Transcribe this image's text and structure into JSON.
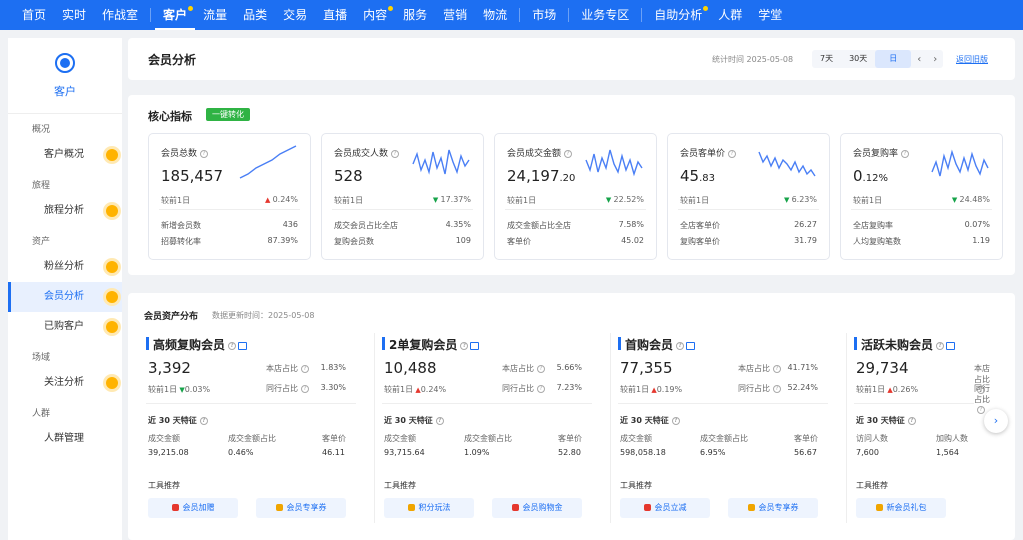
{
  "topnav": {
    "items": [
      {
        "label": "首页",
        "active": false,
        "dot": false
      },
      {
        "label": "实时",
        "active": false,
        "dot": false
      },
      {
        "label": "作战室",
        "active": false,
        "dot": false
      },
      {
        "label": "客户",
        "active": true,
        "dot": true
      },
      {
        "label": "流量",
        "active": false,
        "dot": false
      },
      {
        "label": "品类",
        "active": false,
        "dot": false
      },
      {
        "label": "交易",
        "active": false,
        "dot": false
      },
      {
        "label": "直播",
        "active": false,
        "dot": false
      },
      {
        "label": "内容",
        "active": false,
        "dot": true
      },
      {
        "label": "服务",
        "active": false,
        "dot": false
      },
      {
        "label": "营销",
        "active": false,
        "dot": false
      },
      {
        "label": "物流",
        "active": false,
        "dot": false
      },
      {
        "label": "市场",
        "active": false,
        "dot": false
      },
      {
        "label": "业务专区",
        "active": false,
        "dot": false
      },
      {
        "label": "自助分析",
        "active": false,
        "dot": true
      },
      {
        "label": "人群",
        "active": false,
        "dot": false
      },
      {
        "label": "学堂",
        "active": false,
        "dot": false
      }
    ]
  },
  "sidebar": {
    "title": "客户",
    "groups": [
      {
        "label": "概况",
        "items": [
          {
            "label": "客户概况",
            "active": false
          }
        ]
      },
      {
        "label": "旅程",
        "items": [
          {
            "label": "旅程分析",
            "active": false
          }
        ]
      },
      {
        "label": "资产",
        "items": [
          {
            "label": "粉丝分析",
            "active": false
          },
          {
            "label": "会员分析",
            "active": true
          },
          {
            "label": "已购客户",
            "active": false
          }
        ]
      },
      {
        "label": "场域",
        "items": [
          {
            "label": "关注分析",
            "active": false
          }
        ]
      },
      {
        "label": "人群",
        "items": [
          {
            "label": "人群管理",
            "active": false
          }
        ]
      }
    ]
  },
  "header": {
    "title": "会员分析",
    "stat_time": "统计时间 2025-05-08",
    "tabs": [
      "7天",
      "30天",
      "日"
    ],
    "selected_tab": "日",
    "prev": "‹",
    "next": "›",
    "back_link": "返回旧版"
  },
  "core": {
    "title": "核心指标",
    "one_click": "一键转化",
    "metrics": [
      {
        "name": "会员总数",
        "value_main": "185,457",
        "value_dec": "",
        "cmp_label": "较前1日",
        "change": "0.24%",
        "dir": "up",
        "subs": [
          {
            "label": "新增会员数",
            "value": "436"
          },
          {
            "label": "招募转化率",
            "value": "87.39%"
          }
        ]
      },
      {
        "name": "会员成交人数",
        "value_main": "528",
        "value_dec": "",
        "cmp_label": "较前1日",
        "change": "17.37%",
        "dir": "down",
        "subs": [
          {
            "label": "成交会员占比全店",
            "value": "4.35%"
          },
          {
            "label": "复购会员数",
            "value": "109"
          }
        ]
      },
      {
        "name": "会员成交金额",
        "value_main": "24,197",
        "value_dec": ".20",
        "cmp_label": "较前1日",
        "change": "22.52%",
        "dir": "down",
        "subs": [
          {
            "label": "成交金额占比全店",
            "value": "7.58%"
          },
          {
            "label": "客单价",
            "value": "45.02"
          }
        ]
      },
      {
        "name": "会员客单价",
        "value_main": "45",
        "value_dec": ".83",
        "cmp_label": "较前1日",
        "change": "6.23%",
        "dir": "down",
        "subs": [
          {
            "label": "全店客单价",
            "value": "26.27"
          },
          {
            "label": "复购客单价",
            "value": "31.79"
          }
        ]
      },
      {
        "name": "会员复购率",
        "value_main": "0",
        "value_dec": ".12%",
        "cmp_label": "较前1日",
        "change": "24.48%",
        "dir": "down",
        "subs": [
          {
            "label": "全店复购率",
            "value": "0.07%"
          },
          {
            "label": "人均复购笔数",
            "value": "1.19"
          }
        ]
      }
    ]
  },
  "assets": {
    "title": "会员资产分布",
    "update_time": "数据更新时间：2025-05-08",
    "feature_title": "近 30 天特征",
    "tools_title": "工具推荐",
    "segments": [
      {
        "title": "高频复购会员",
        "value": "3,392",
        "cmp_label": "较前1日",
        "change": "0.03%",
        "dir": "down",
        "r1_label": "本店占比",
        "r1_value": "1.83%",
        "r2_label": "同行占比",
        "r2_value": "3.30%",
        "features": [
          {
            "label": "成交金额",
            "value": "39,215.08"
          },
          {
            "label": "成交金额占比",
            "value": "0.46%"
          },
          {
            "label": "客单价",
            "value": "46.11"
          }
        ],
        "tools": [
          "会员加赠",
          "会员专享券"
        ]
      },
      {
        "title": "2单复购会员",
        "value": "10,488",
        "cmp_label": "较前1日",
        "change": "0.24%",
        "dir": "up",
        "r1_label": "本店占比",
        "r1_value": "5.66%",
        "r2_label": "同行占比",
        "r2_value": "7.23%",
        "features": [
          {
            "label": "成交金额",
            "value": "93,715.64"
          },
          {
            "label": "成交金额占比",
            "value": "1.09%"
          },
          {
            "label": "客单价",
            "value": "52.80"
          }
        ],
        "tools": [
          "积分玩法",
          "会员购物金"
        ]
      },
      {
        "title": "首购会员",
        "value": "77,355",
        "cmp_label": "较前1日",
        "change": "0.19%",
        "dir": "up",
        "r1_label": "本店占比",
        "r1_value": "41.71%",
        "r2_label": "同行占比",
        "r2_value": "52.24%",
        "features": [
          {
            "label": "成交金额",
            "value": "598,058.18"
          },
          {
            "label": "成交金额占比",
            "value": "6.95%"
          },
          {
            "label": "客单价",
            "value": "56.67"
          }
        ],
        "tools": [
          "会员立减",
          "会员专享券"
        ]
      },
      {
        "title": "活跃未购会员",
        "value": "29,734",
        "cmp_label": "较前1日",
        "change": "0.26%",
        "dir": "up",
        "r1_label": "本店占比",
        "r1_value": "",
        "r2_label": "同行占比",
        "r2_value": "",
        "features": [
          {
            "label": "访问人数",
            "value": "7,600"
          },
          {
            "label": "加购人数",
            "value": "1,564"
          },
          {
            "label": "",
            "value": ""
          }
        ],
        "tools": [
          "新会员礼包"
        ]
      }
    ],
    "next_arrow": "›"
  },
  "colors": {
    "brand": "#1d6ff2",
    "up": "#e5372e",
    "down": "#17a34a",
    "accent_dot": "#ffb300"
  }
}
